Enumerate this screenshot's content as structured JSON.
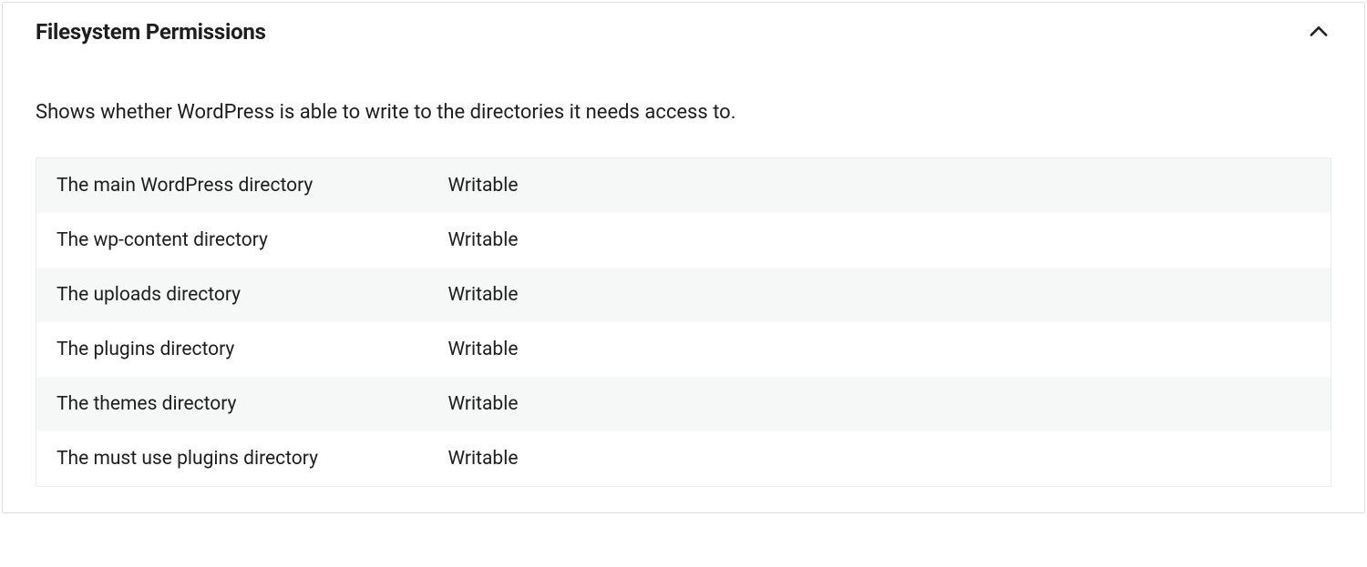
{
  "panel": {
    "title": "Filesystem Permissions",
    "description": "Shows whether WordPress is able to write to the directories it needs access to.",
    "rows": [
      {
        "label": "The main WordPress directory",
        "value": "Writable"
      },
      {
        "label": "The wp-content directory",
        "value": "Writable"
      },
      {
        "label": "The uploads directory",
        "value": "Writable"
      },
      {
        "label": "The plugins directory",
        "value": "Writable"
      },
      {
        "label": "The themes directory",
        "value": "Writable"
      },
      {
        "label": "The must use plugins directory",
        "value": "Writable"
      }
    ]
  }
}
